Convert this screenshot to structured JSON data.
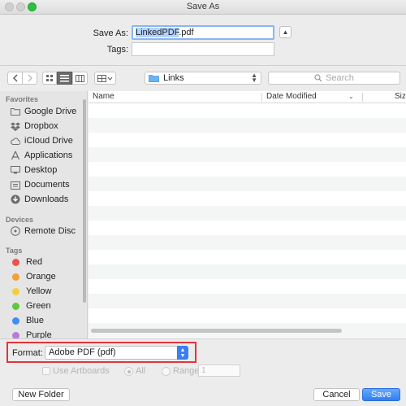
{
  "window": {
    "title": "Save As"
  },
  "form": {
    "saveas_label": "Save As:",
    "filename_selected": "LinkedPDF",
    "filename_ext": ".pdf",
    "tags_label": "Tags:",
    "tags_value": ""
  },
  "toolbar": {
    "location": "Links",
    "search_placeholder": "Search",
    "active_view": "list"
  },
  "sidebar": {
    "favorites_header": "Favorites",
    "favorites": [
      {
        "label": "Google Drive",
        "icon": "folder-icon"
      },
      {
        "label": "Dropbox",
        "icon": "dropbox-icon"
      },
      {
        "label": "iCloud Drive",
        "icon": "cloud-icon"
      },
      {
        "label": "Applications",
        "icon": "applications-icon"
      },
      {
        "label": "Desktop",
        "icon": "desktop-icon"
      },
      {
        "label": "Documents",
        "icon": "documents-icon"
      },
      {
        "label": "Downloads",
        "icon": "downloads-icon"
      }
    ],
    "devices_header": "Devices",
    "devices": [
      {
        "label": "Remote Disc",
        "icon": "disc-icon"
      }
    ],
    "tags_header": "Tags",
    "tags": [
      {
        "label": "Red",
        "color": "#f0504f"
      },
      {
        "label": "Orange",
        "color": "#f5a033"
      },
      {
        "label": "Yellow",
        "color": "#f3cf3d"
      },
      {
        "label": "Green",
        "color": "#5cc843"
      },
      {
        "label": "Blue",
        "color": "#3d8ef5"
      },
      {
        "label": "Purple",
        "color": "#b97ad9"
      }
    ]
  },
  "filelist": {
    "columns": [
      "Name",
      "Date Modified",
      "Siz"
    ]
  },
  "bottom": {
    "format_label": "Format:",
    "format_value": "Adobe PDF (pdf)",
    "use_artboards": "Use Artboards",
    "all": "All",
    "range": "Range:",
    "range_value": "1",
    "new_folder": "New Folder",
    "cancel": "Cancel",
    "save": "Save"
  },
  "colors": {
    "accent": "#3a7ef5",
    "highlight": "#e2343a"
  }
}
